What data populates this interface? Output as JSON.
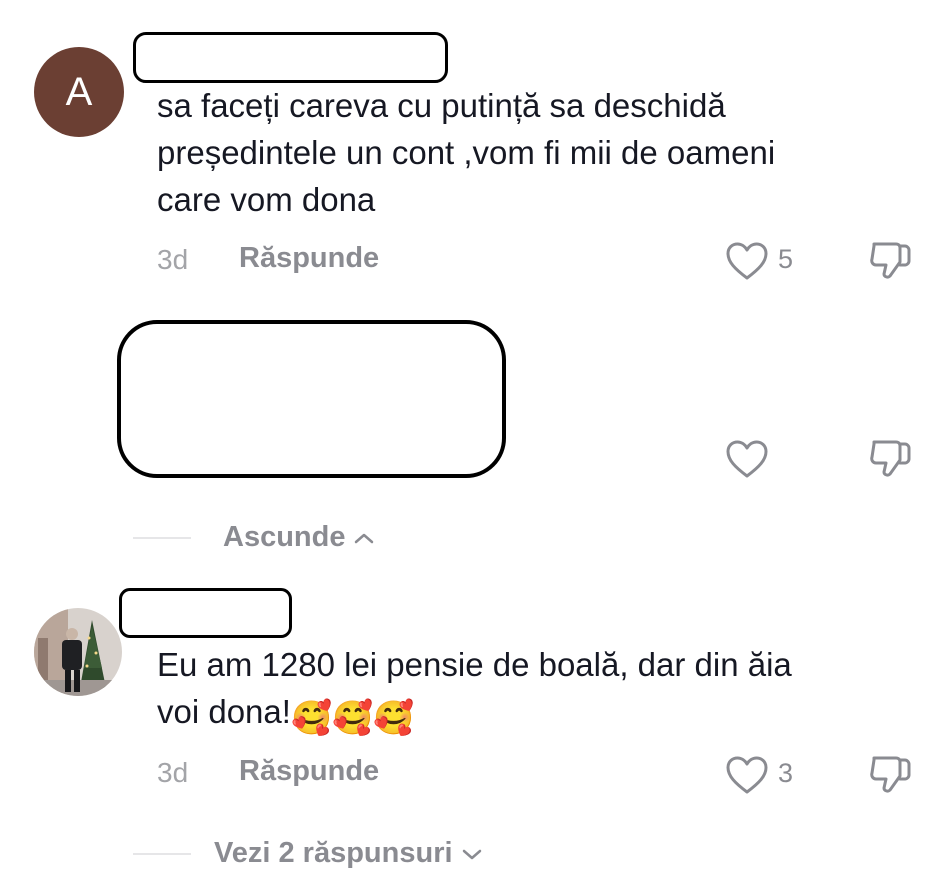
{
  "comments": [
    {
      "avatar_letter": "A",
      "avatar_color": "#6b3f33",
      "text": "sa faceți careva cu putință sa deschidă\npreședintele un cont ,vom fi mii de oameni\ncare vom dona",
      "time": "3d",
      "reply_label": "Răspunde",
      "likes": "5"
    },
    {
      "text": "",
      "likes": ""
    },
    {
      "text": "Eu am 1280 lei pensie de boală, dar din ăia\nvoi dona!",
      "emojis": "🥰🥰🥰",
      "time": "3d",
      "reply_label": "Răspunde",
      "likes": "3"
    }
  ],
  "toggles": {
    "hide_replies": "Ascunde",
    "view_replies": "Vezi 2 răspunsuri"
  },
  "icons": {
    "like": "heart-outline-icon",
    "dislike": "thumbs-down-outline-icon",
    "chevron_up": "chevron-up-icon",
    "chevron_down": "chevron-down-icon"
  },
  "colors": {
    "text": "#161823",
    "muted": "#8a8b91",
    "time": "#a3a4a8",
    "avatar_a": "#6b3f33"
  }
}
